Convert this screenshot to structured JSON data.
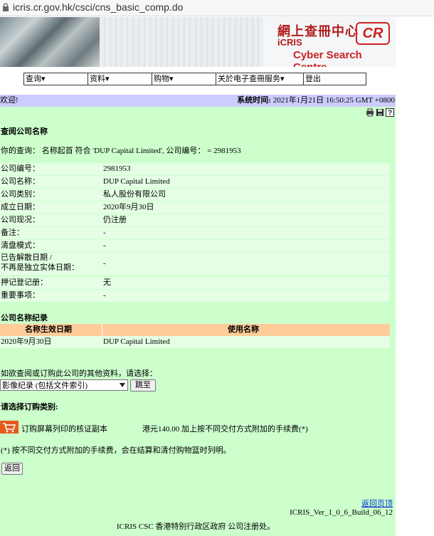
{
  "browser": {
    "url": "icris.cr.gov.hk/csci/cns_basic_comp.do"
  },
  "banner": {
    "logo_cn": "網上查冊中心",
    "logo_icris": "iCRIS",
    "logo_csc": "Cyber Search Centre",
    "logo_cr": "CR"
  },
  "menu": [
    {
      "label": "查询▾"
    },
    {
      "label": "资料▾"
    },
    {
      "label": "购物▾"
    },
    {
      "label": "关於电子查冊服务▾"
    },
    {
      "label": "登出"
    }
  ],
  "header": {
    "welcome": "欢迎!",
    "systime_label": "系统时间:",
    "systime_value": "2021年1月21日 16:50:25 GMT +0800"
  },
  "page_title": "查阅公司名称",
  "query_text": "你的查询： 名称起首 符合 'DUP Capital Limited', 公司编号： = 2981953",
  "fields": [
    {
      "label": "公司编号：",
      "value": "2981953"
    },
    {
      "label": "公司名称：",
      "value": "DUP Capital Limited"
    },
    {
      "label": "公司类别：",
      "value": "私人股份有限公司"
    },
    {
      "label": "成立日期：",
      "value": "2020年9月30日"
    },
    {
      "label": "公司现况：",
      "value": "仍注册"
    },
    {
      "label": "备注：",
      "value": "-"
    },
    {
      "label": "清盘模式：",
      "value": "-"
    },
    {
      "label": "已告解散日期 /",
      "label2": "不再是独立实体日期：",
      "value": "-"
    },
    {
      "label": "押记登记册：",
      "value": "无"
    },
    {
      "label": "重要事项：",
      "value": "-"
    }
  ],
  "name_history": {
    "title": "公司名称纪录",
    "col1": "名称生效日期",
    "col2": "使用名称",
    "rows": [
      {
        "date": "2020年9月30日",
        "name": "DUP Capital Limited"
      }
    ]
  },
  "more_info": {
    "prompt": "如欲查阅或订购此公司的其他资料，请选择：",
    "select_value": "影像纪录 (包括文件索引)",
    "go_button": "跳至"
  },
  "order": {
    "title": "请选择订购类别:",
    "item": "订购屏幕列印的核证副本",
    "price": "港元140.00 加上按不同交付方式附加的手续费(*)",
    "note": "(*) 按不同交付方式附加的手续费，会在结算和清付购物篮时列明。",
    "back_button": "返回"
  },
  "footer": {
    "back_to_top": "返回页顶",
    "version": "ICRIS_Ver_1_0_6_Build_06_12",
    "credit": "ICRIS CSC 香港特别行政区政府 公司注册处。"
  }
}
